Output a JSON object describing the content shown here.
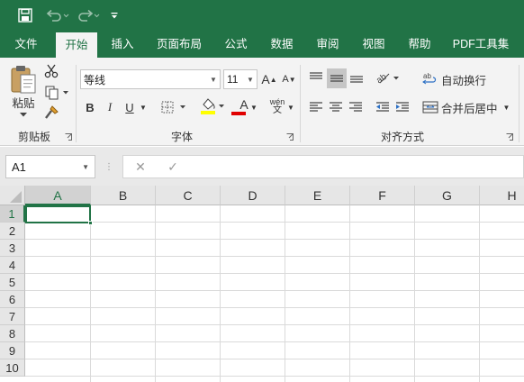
{
  "colors": {
    "brand": "#217346",
    "ribbon_bg": "#f3f3f3",
    "font_color_bar": "#e00000",
    "highlight_bar": "#ffff00"
  },
  "quick_access": {
    "save_icon": "save-icon",
    "undo_icon": "undo-icon",
    "redo_icon": "redo-icon",
    "customize_icon": "customize-quick-access-icon"
  },
  "tabs": [
    {
      "label": "文件"
    },
    {
      "label": "开始",
      "active": true
    },
    {
      "label": "插入"
    },
    {
      "label": "页面布局"
    },
    {
      "label": "公式"
    },
    {
      "label": "数据"
    },
    {
      "label": "审阅"
    },
    {
      "label": "视图"
    },
    {
      "label": "帮助"
    },
    {
      "label": "PDF工具集"
    }
  ],
  "ribbon": {
    "clipboard": {
      "paste_label": "粘贴",
      "group_label": "剪贴板"
    },
    "font": {
      "font_name": "等线",
      "font_size": "11",
      "group_label": "字体",
      "grow_label": "A",
      "shrink_label": "A",
      "bold": "B",
      "italic": "I",
      "underline": "U",
      "phonetic": "wén",
      "font_color_glyph": "A"
    },
    "alignment": {
      "wrap_text": "自动换行",
      "merge_center": "合并后居中",
      "group_label": "对齐方式"
    }
  },
  "formula_bar": {
    "name_box": "A1",
    "cancel": "✕",
    "enter": "✓",
    "formula": ""
  },
  "sheet": {
    "columns": [
      "A",
      "B",
      "C",
      "D",
      "E",
      "F",
      "G",
      "H"
    ],
    "rows": [
      "1",
      "2",
      "3",
      "4",
      "5",
      "6",
      "7",
      "8",
      "9",
      "10"
    ],
    "active_cell": "A1"
  }
}
